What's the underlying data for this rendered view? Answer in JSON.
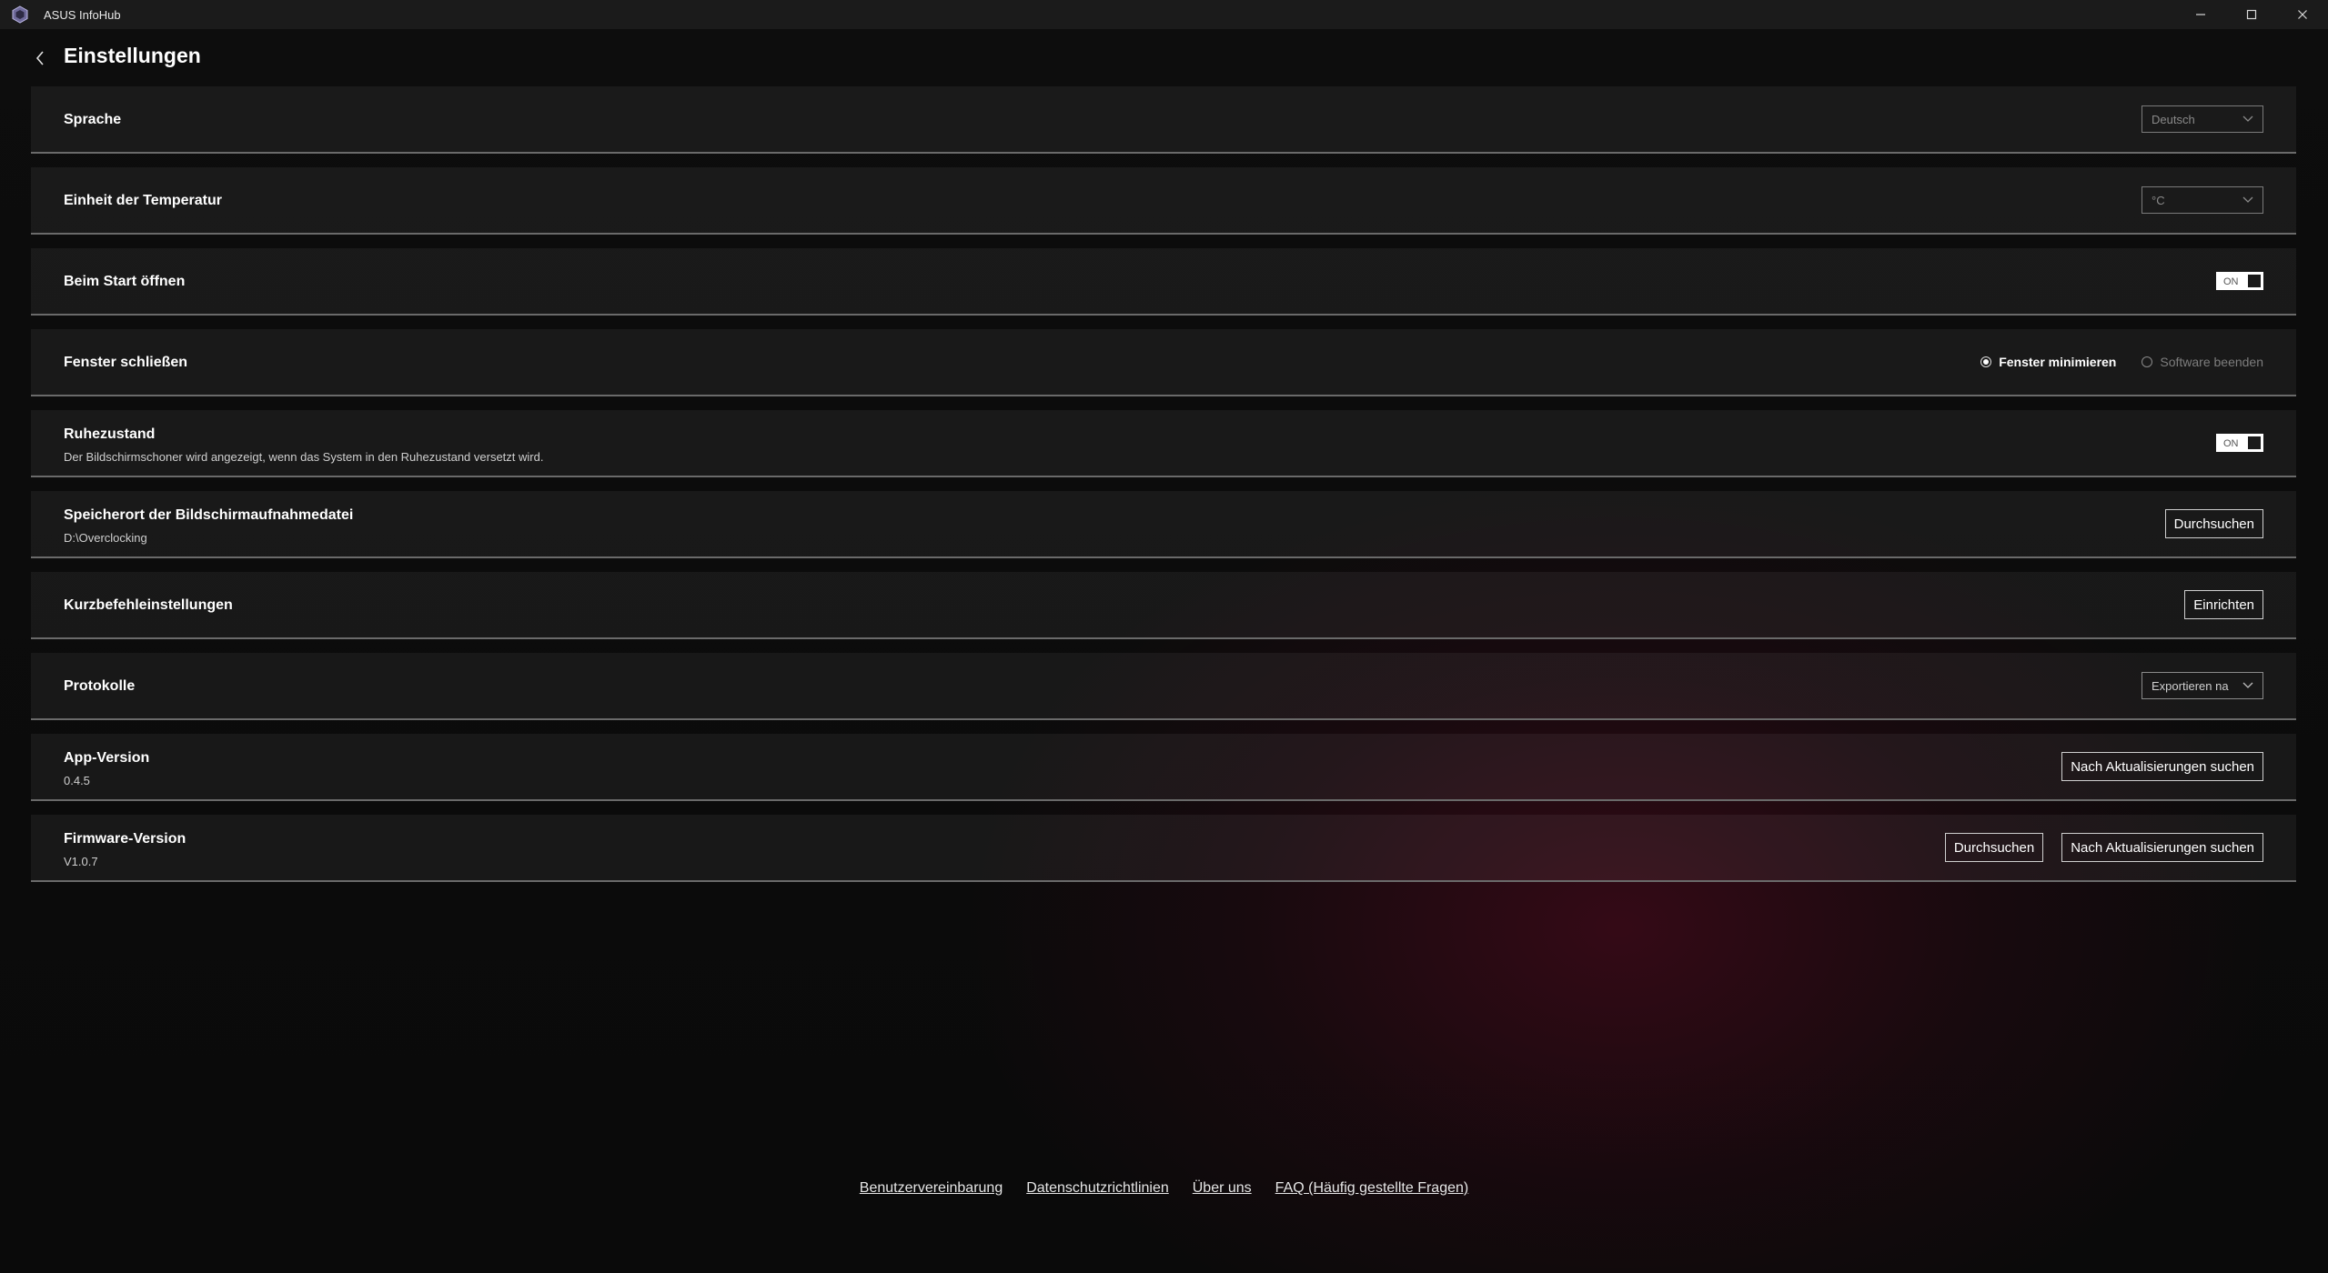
{
  "window": {
    "app_title": "ASUS InfoHub",
    "logo_icon": "asus-infohub-logo",
    "controls": {
      "minimize": "minimize-icon",
      "maximize": "maximize-icon",
      "close": "close-icon"
    }
  },
  "header": {
    "title": "Einstellungen",
    "back_icon": "chevron-left-icon"
  },
  "settings": {
    "language": {
      "label": "Sprache",
      "value": "Deutsch"
    },
    "temperature_unit": {
      "label": "Einheit der Temperatur",
      "value": "°C"
    },
    "open_on_start": {
      "label": "Beim Start öffnen",
      "toggle_text": "ON",
      "state": true
    },
    "close_window": {
      "label": "Fenster schließen",
      "options": [
        {
          "label": "Fenster minimieren",
          "selected": true
        },
        {
          "label": "Software beenden",
          "selected": false
        }
      ]
    },
    "sleep_mode": {
      "label": "Ruhezustand",
      "description": "Der Bildschirmschoner wird angezeigt, wenn das System in den Ruhezustand versetzt wird.",
      "toggle_text": "ON",
      "state": true
    },
    "screenshot_location": {
      "label": "Speicherort der Bildschirmaufnahmedatei",
      "path": "D:\\Overclocking",
      "button": "Durchsuchen"
    },
    "shortcuts": {
      "label": "Kurzbefehleinstellungen",
      "button": "Einrichten"
    },
    "logs": {
      "label": "Protokolle",
      "value": "Exportieren na"
    },
    "app_version": {
      "label": "App-Version",
      "value": "0.4.5",
      "button": "Nach Aktualisierungen suchen"
    },
    "firmware_version": {
      "label": "Firmware-Version",
      "value": "V1.0.7",
      "browse_button": "Durchsuchen",
      "update_button": "Nach Aktualisierungen suchen"
    }
  },
  "footer": {
    "links": [
      "Benutzervereinbarung",
      "Datenschutzrichtlinien",
      "Über uns",
      "FAQ (Häufig gestellte Fragen)"
    ]
  }
}
